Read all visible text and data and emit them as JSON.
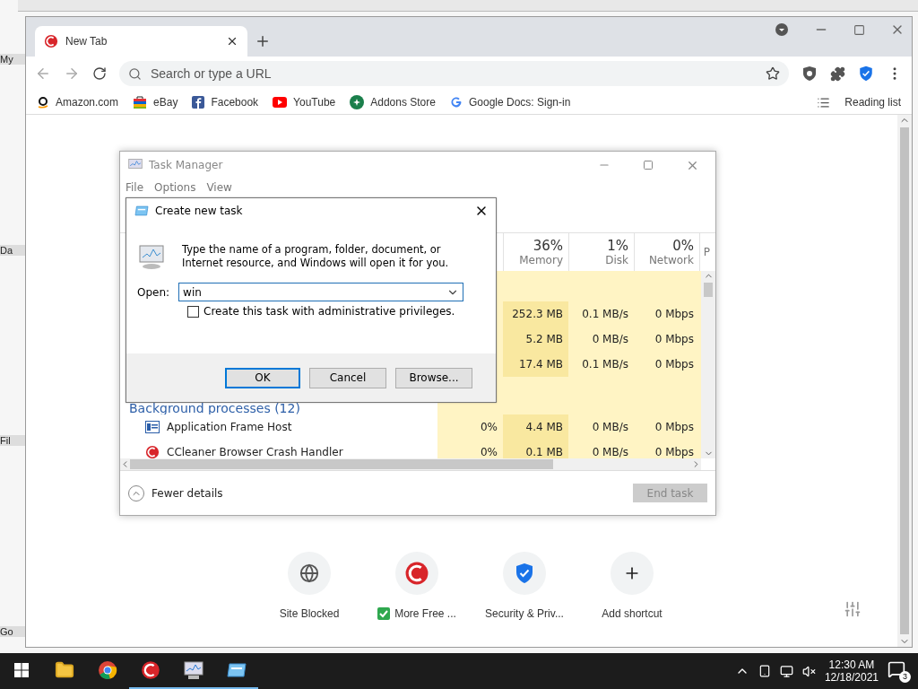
{
  "desktop_icons": [
    {
      "label": "My"
    },
    {
      "label": "Da"
    },
    {
      "label": "Fil"
    },
    {
      "label": "Go"
    }
  ],
  "browser": {
    "tabs": [
      {
        "title": "New Tab",
        "selected": true
      }
    ],
    "address": {
      "placeholder": "Search or type a URL"
    },
    "bookmarks": [
      {
        "label": "Amazon.com",
        "kind": "amazon"
      },
      {
        "label": "eBay",
        "kind": "ebay"
      },
      {
        "label": "Facebook",
        "kind": "facebook"
      },
      {
        "label": "YouTube",
        "kind": "youtube"
      },
      {
        "label": "Addons Store",
        "kind": "addons"
      },
      {
        "label": "Google Docs: Sign-in",
        "kind": "google"
      }
    ],
    "reading_list": "Reading list",
    "shortcuts": [
      {
        "label": "Site Blocked",
        "kind": "globe",
        "verified": false
      },
      {
        "label": "More Free ...",
        "kind": "ccleaner",
        "verified": true
      },
      {
        "label": "Security & Priv...",
        "kind": "shield",
        "verified": false
      },
      {
        "label": "Add shortcut",
        "kind": "add",
        "verified": false
      }
    ]
  },
  "task_manager": {
    "title": "Task Manager",
    "menu": [
      "File",
      "Options",
      "View"
    ],
    "columns": [
      {
        "value": "36%",
        "label": "Memory"
      },
      {
        "value": "1%",
        "label": "Disk"
      },
      {
        "value": "0%",
        "label": "Network"
      },
      {
        "label": "P"
      }
    ],
    "rows": [
      {
        "kind": "process",
        "memory": "252.3 MB",
        "disk": "0.1 MB/s",
        "network": "0 Mbps"
      },
      {
        "kind": "process",
        "memory": "5.2 MB",
        "disk": "0 MB/s",
        "network": "0 Mbps"
      },
      {
        "kind": "process",
        "memory": "17.4 MB",
        "disk": "0.1 MB/s",
        "network": "0 Mbps"
      },
      {
        "kind": "group",
        "name": "Background processes (12)"
      },
      {
        "kind": "process",
        "name": "Application Frame Host",
        "cpu": "0%",
        "memory": "4.4 MB",
        "disk": "0 MB/s",
        "network": "0 Mbps"
      },
      {
        "kind": "process",
        "name": "CCleaner Browser Crash Handler",
        "cpu": "0%",
        "memory": "0.1 MB",
        "disk": "0 MB/s",
        "network": "0 Mbps"
      }
    ],
    "fewer_details": "Fewer details",
    "end_task": {
      "label": "End task",
      "disabled": true
    }
  },
  "dialog": {
    "title": "Create new task",
    "message": "Type the name of a program, folder, document, or Internet resource, and Windows will open it for you.",
    "open_label": "Open:",
    "open_value": "win",
    "admin": {
      "label": "Create this task with administrative privileges.",
      "checked": false
    },
    "buttons": [
      {
        "label": "OK",
        "selected": true
      },
      {
        "label": "Cancel",
        "selected": false
      },
      {
        "label": "Browse...",
        "selected": false
      }
    ]
  },
  "taskbar": {
    "apps": [
      {
        "kind": "folder",
        "active": false
      },
      {
        "kind": "chrome",
        "active": false
      },
      {
        "kind": "ccleaner",
        "active": true
      },
      {
        "kind": "taskmgr",
        "active": true
      },
      {
        "kind": "run",
        "active": true
      }
    ],
    "time": "12:30 AM",
    "date": "12/18/2021",
    "notifications": "3"
  }
}
